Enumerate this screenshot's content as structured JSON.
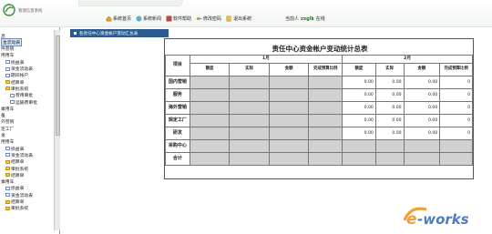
{
  "header": {
    "app_title": "管理信息系统",
    "nav": [
      {
        "label": "系统首页",
        "icon": "home-icon"
      },
      {
        "label": "系统新闻",
        "icon": "news-icon"
      },
      {
        "label": "软件帮助",
        "icon": "help-book-icon"
      },
      {
        "label": "修改密码",
        "icon": "key-icon"
      },
      {
        "label": "退出系统",
        "icon": "exit-icon"
      }
    ],
    "user_prefix": "当前人",
    "user_name": "zxglk",
    "user_status": "在线"
  },
  "sidebar": {
    "items": [
      {
        "label": "息",
        "kind": "text",
        "indent": 0
      },
      {
        "label": "金流动表",
        "kind": "text",
        "indent": 0,
        "selected": true
      },
      {
        "label": "件营销",
        "kind": "text",
        "indent": 0
      },
      {
        "label": "用用车",
        "kind": "text",
        "indent": 0
      },
      {
        "label": "损益表",
        "kind": "page",
        "indent": 1
      },
      {
        "label": "资金流动表",
        "kind": "page",
        "indent": 1
      },
      {
        "label": "期间帐户",
        "kind": "page",
        "indent": 1
      },
      {
        "label": "结算单",
        "kind": "folder",
        "indent": 1
      },
      {
        "label": "审批系统",
        "kind": "folder",
        "indent": 1
      },
      {
        "label": "费用审批",
        "kind": "page",
        "indent": 2
      },
      {
        "label": "运输费审批",
        "kind": "page",
        "indent": 2
      },
      {
        "label": "乘用车",
        "kind": "text",
        "indent": 0
      },
      {
        "label": "备",
        "kind": "text",
        "indent": 0
      },
      {
        "label": "外营销",
        "kind": "text",
        "indent": 0
      },
      {
        "label": "定工厂",
        "kind": "text",
        "indent": 0
      },
      {
        "label": "发",
        "kind": "text",
        "indent": 0
      },
      {
        "label": "用用车",
        "kind": "text",
        "indent": 0
      },
      {
        "label": "损益表",
        "kind": "page",
        "indent": 1
      },
      {
        "label": "资金流动表",
        "kind": "page",
        "indent": 1
      },
      {
        "label": "结算单",
        "kind": "folder",
        "indent": 1
      },
      {
        "label": "审批系统",
        "kind": "folder",
        "indent": 1
      },
      {
        "label": "结算单",
        "kind": "folder",
        "indent": 1
      },
      {
        "label": "乘用车",
        "kind": "text",
        "indent": 0
      },
      {
        "label": "损益表",
        "kind": "page",
        "indent": 1
      },
      {
        "label": "资金流动表",
        "kind": "page",
        "indent": 1
      },
      {
        "label": "结算单",
        "kind": "folder",
        "indent": 1
      },
      {
        "label": "审批系统",
        "kind": "folder",
        "indent": 1
      }
    ]
  },
  "tab": {
    "label": "各责任中心资金帐户变动汇总表"
  },
  "report": {
    "title": "责任中心资金帐户变动统计总表",
    "row_header": "项目",
    "months": [
      "1月",
      "2月"
    ],
    "subcols": [
      "额度",
      "实际",
      "金额",
      "完成预算比例"
    ],
    "rows": [
      {
        "label": "国内营销",
        "m1": [
          "",
          "",
          "",
          ""
        ],
        "m2": [
          "0.00",
          "0.00",
          "0.00",
          "0"
        ]
      },
      {
        "label": "服务",
        "m1": [
          "",
          "",
          "",
          ""
        ],
        "m2": [
          "0.00",
          "0.00",
          "0.00",
          "0"
        ]
      },
      {
        "label": "海外营销",
        "m1": [
          "",
          "",
          "",
          ""
        ],
        "m2": [
          "0.00",
          "0.00",
          "0.00",
          "0"
        ]
      },
      {
        "label": "规定工厂",
        "m1": [
          "",
          "",
          "",
          ""
        ],
        "m2": [
          "0.00",
          "0.00",
          "0.00",
          "0"
        ]
      },
      {
        "label": "研发",
        "m1": [
          "",
          "",
          "",
          ""
        ],
        "m2": [
          "0.00",
          "0.00",
          "0.00",
          "0"
        ]
      },
      {
        "label": "采购中心",
        "m1": [
          "",
          "",
          "",
          ""
        ],
        "m2": [
          "",
          "",
          "",
          ""
        ]
      },
      {
        "label": "合计",
        "m1": [
          "",
          "",
          "",
          ""
        ],
        "m2": [
          "",
          "",
          "",
          ""
        ]
      }
    ]
  },
  "watermark": {
    "text": "e-works"
  },
  "colors": {
    "tab_bg": "#2c5c8f",
    "user_green": "#1a7a1a",
    "watermark_orange": "#f0a030",
    "watermark_blue": "#4b7fc1"
  }
}
